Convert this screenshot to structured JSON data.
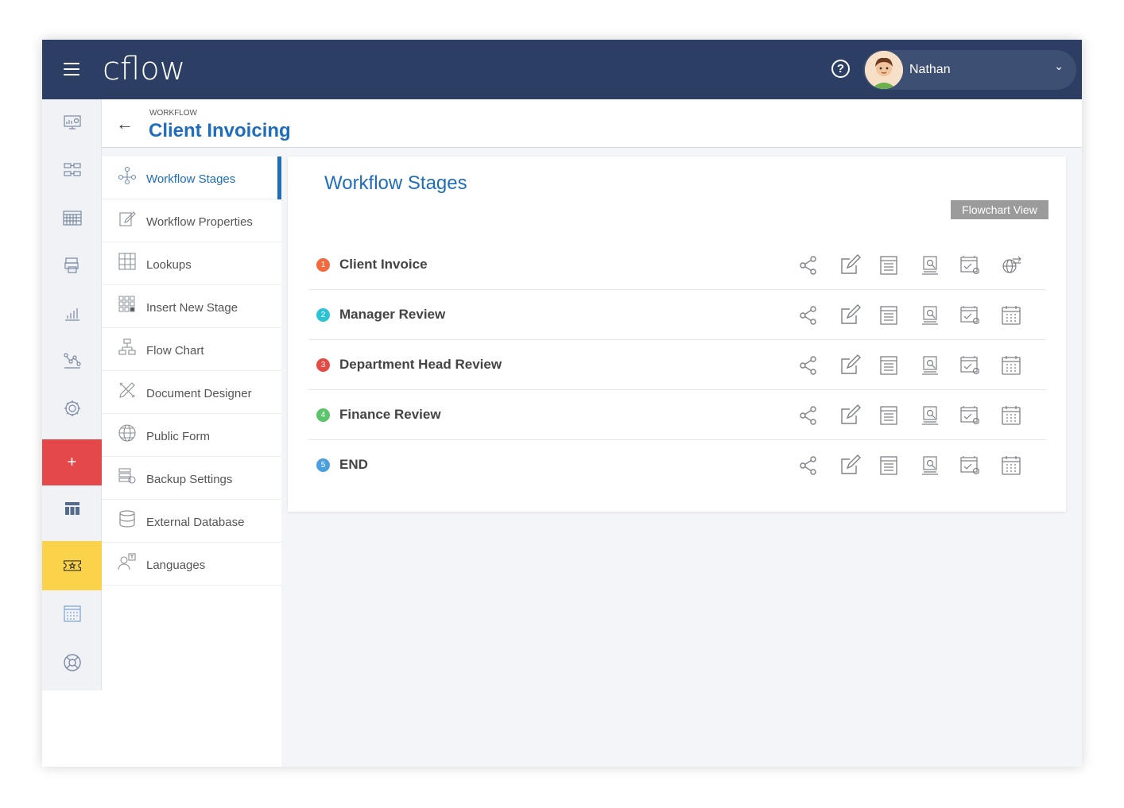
{
  "app": {
    "logo_text": "cflow"
  },
  "user": {
    "name": "Nathan"
  },
  "breadcrumb": "WORKFLOW",
  "page_title": "Client Invoicing",
  "colors": {
    "topbar": "#2c3e64",
    "accent": "#1f6dbd",
    "add": "#e4484b",
    "yellow": "#fbd34b"
  },
  "rail": [
    {
      "name": "dashboard-icon"
    },
    {
      "name": "workflow-icon"
    },
    {
      "name": "calendar-grid-icon"
    },
    {
      "name": "printer-icon"
    },
    {
      "name": "reports-icon"
    },
    {
      "name": "analytics-icon"
    },
    {
      "name": "settings-icon"
    },
    {
      "name": "add-icon",
      "label": "+"
    },
    {
      "name": "table-icon"
    },
    {
      "name": "ticket-icon"
    },
    {
      "name": "calendar-icon"
    },
    {
      "name": "support-icon"
    }
  ],
  "sidenav": [
    {
      "label": "Workflow Stages",
      "icon": "workflow-stages-icon",
      "active": true
    },
    {
      "label": "Workflow Properties",
      "icon": "edit-properties-icon"
    },
    {
      "label": "Lookups",
      "icon": "lookup-table-icon"
    },
    {
      "label": "Insert New Stage",
      "icon": "insert-stage-icon"
    },
    {
      "label": "Flow Chart",
      "icon": "flow-chart-icon"
    },
    {
      "label": "Document Designer",
      "icon": "document-designer-icon"
    },
    {
      "label": "Public Form",
      "icon": "globe-icon"
    },
    {
      "label": "Backup Settings",
      "icon": "backup-icon"
    },
    {
      "label": "External Database",
      "icon": "database-icon"
    },
    {
      "label": "Languages",
      "icon": "languages-icon"
    }
  ],
  "card": {
    "title": "Workflow Stages",
    "flowchart_button": "Flowchart View",
    "stages": [
      {
        "num": "1",
        "name": "Client Invoice",
        "color": "#f26a3d",
        "last_icon": "globe-transfer-icon"
      },
      {
        "num": "2",
        "name": "Manager Review",
        "color": "#2cc4d4",
        "last_icon": "calendar-icon"
      },
      {
        "num": "3",
        "name": "Department Head Review",
        "color": "#e54a44",
        "last_icon": "calendar-icon"
      },
      {
        "num": "4",
        "name": "Finance Review",
        "color": "#5cc56b",
        "last_icon": "calendar-icon"
      },
      {
        "num": "5",
        "name": "END",
        "color": "#4a9fe0",
        "last_icon": "calendar-icon"
      }
    ]
  }
}
